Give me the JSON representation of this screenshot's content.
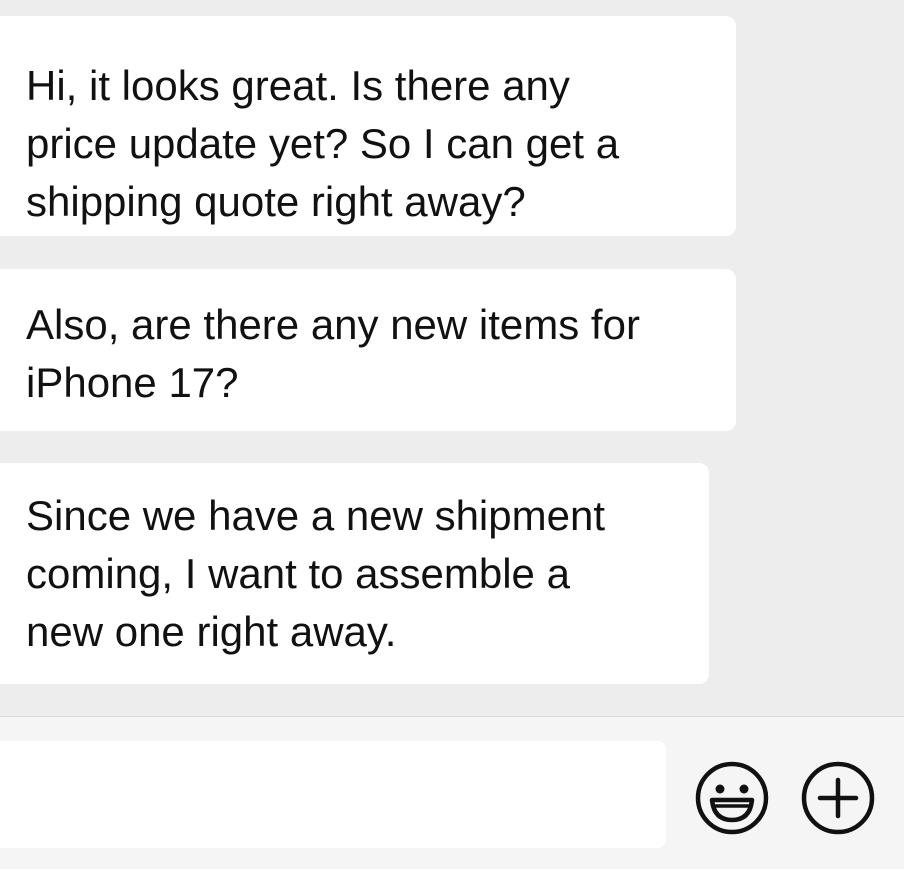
{
  "messages": [
    {
      "text": "Hi, it looks great. Is there any\nprice update yet? So I can get a\nshipping quote right away?"
    },
    {
      "text": "Also, are there any new items for\niPhone 17?"
    },
    {
      "text": "Since we have a new shipment\ncoming, I want to assemble a\nnew one right away."
    }
  ],
  "composer": {
    "value": "",
    "emoji_icon": "emoji-smile-icon",
    "add_icon": "plus-circle-icon"
  },
  "colors": {
    "background": "#ededed",
    "bubble": "#ffffff",
    "input_bar": "#f5f5f5",
    "text": "#111111"
  }
}
